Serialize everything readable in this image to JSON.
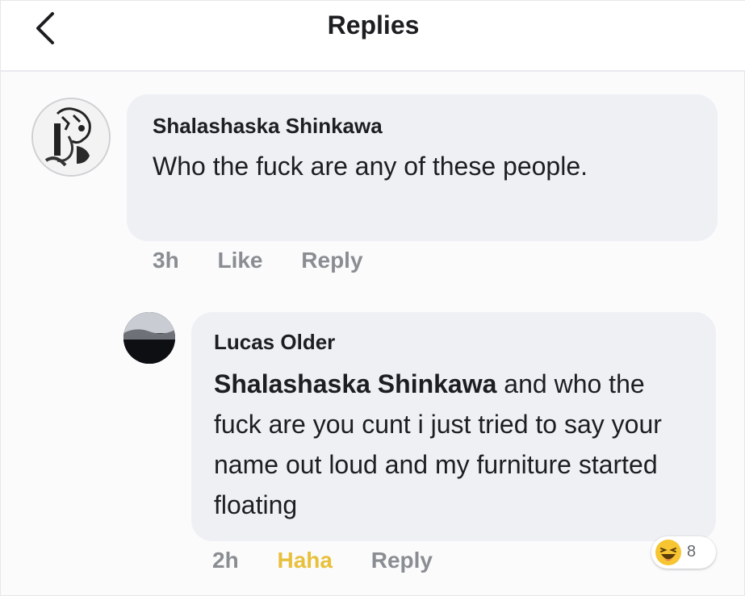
{
  "header": {
    "title": "Replies",
    "back_icon": "chevron-left-icon"
  },
  "comments": [
    {
      "author": "Shalashaska Shinkawa",
      "avatar_icon": "sketch-portrait-avatar",
      "text": "Who the fuck are any of these people.",
      "time": "3h",
      "like_label": "Like",
      "reply_label": "Reply"
    },
    {
      "author": "Lucas Older",
      "avatar_icon": "dark-landscape-avatar",
      "mention": "Shalashaska Shinkawa",
      "text": " and who the fuck are you cunt i just tried to say your name out loud and my furniture started floating",
      "time": "2h",
      "reaction_label": "Haha",
      "reply_label": "Reply",
      "reaction_icon": "haha-emoji-icon",
      "reaction_count": "8"
    }
  ],
  "colors": {
    "bubble": "#eef0f4",
    "meta_text": "#8a8d91",
    "haha": "#e8c03b"
  }
}
